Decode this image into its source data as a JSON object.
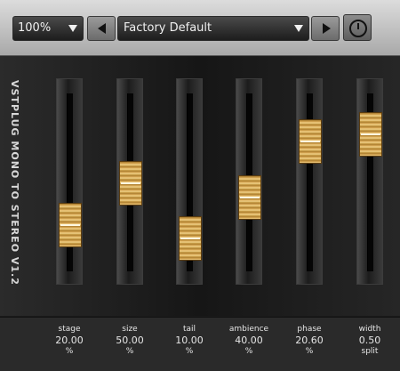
{
  "toolbar": {
    "zoom": "100%",
    "preset": "Factory Default"
  },
  "plugin_title": "VSTPLUG MONO TO STEREO V1.2",
  "faders": [
    {
      "label": "stage",
      "value": "20.00",
      "unit": "%",
      "level": 0.2
    },
    {
      "label": "size",
      "value": "50.00",
      "unit": "%",
      "level": 0.5
    },
    {
      "label": "tail",
      "value": "10.00",
      "unit": "%",
      "level": 0.1
    },
    {
      "label": "ambience",
      "value": "40.00",
      "unit": "%",
      "level": 0.4
    },
    {
      "label": "phase",
      "value": "20.60",
      "unit": "%",
      "level": 0.8
    },
    {
      "label": "width",
      "value": "0.50",
      "unit": "split",
      "level": 0.85
    }
  ]
}
